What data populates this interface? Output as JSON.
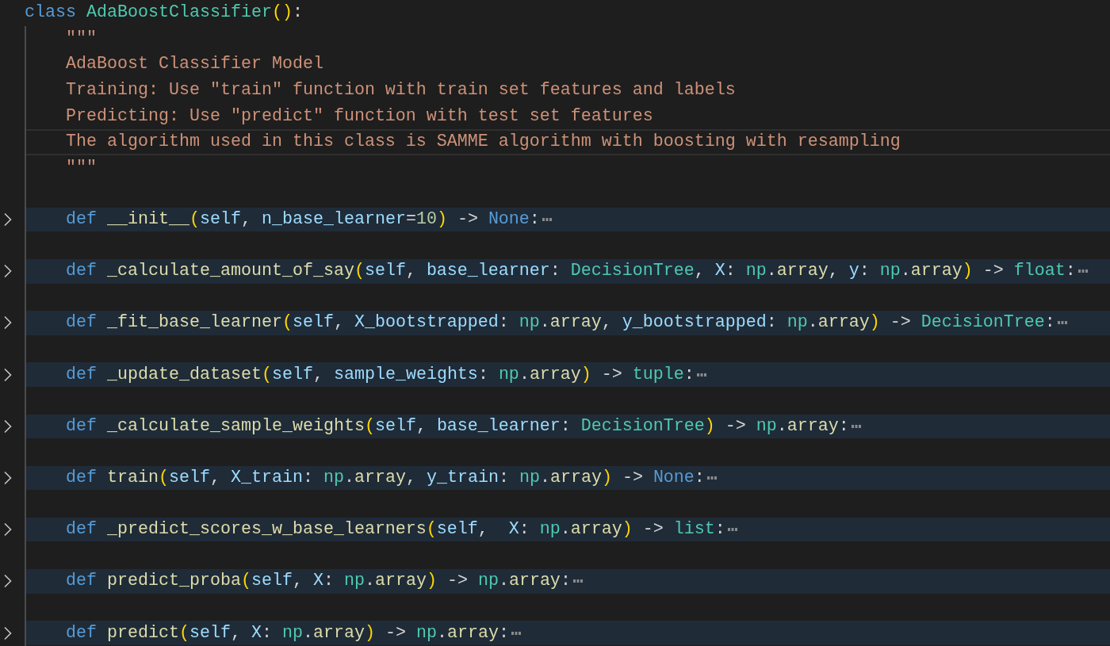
{
  "editor": {
    "lines": [
      {
        "kind": "code",
        "current": false,
        "tokens": [
          {
            "text": "class ",
            "kind": "keyword"
          },
          {
            "text": "AdaBoostClassifier",
            "kind": "class"
          },
          {
            "text": "()",
            "kind": "bracket"
          },
          {
            "text": ":",
            "kind": "plain"
          }
        ],
        "children": [
          {
            "kind": "code",
            "current": false,
            "tokens": [
              {
                "text": "\"\"\"",
                "kind": "string"
              }
            ]
          },
          {
            "kind": "code",
            "current": false,
            "tokens": [
              {
                "text": "AdaBoost Classifier Model",
                "kind": "string"
              }
            ]
          },
          {
            "kind": "code",
            "current": false,
            "tokens": [
              {
                "text": "Training: Use \"train\" function with train set features and labels",
                "kind": "string"
              }
            ]
          },
          {
            "kind": "code",
            "current": false,
            "tokens": [
              {
                "text": "Predicting: Use \"predict\" function with test set features",
                "kind": "string"
              }
            ]
          },
          {
            "kind": "code",
            "current": true,
            "tokens": [
              {
                "text": "The algorithm used in this class is SAMME algorithm with boosting with resampling",
                "kind": "string"
              }
            ]
          },
          {
            "kind": "code",
            "current": false,
            "tokens": [
              {
                "text": "\"\"\"",
                "kind": "string"
              }
            ]
          },
          {
            "kind": "blank",
            "current": false
          },
          {
            "kind": "folded",
            "current": false,
            "tokens": [
              {
                "text": "def ",
                "kind": "keyword"
              },
              {
                "text": "__init__",
                "kind": "function"
              },
              {
                "text": "(",
                "kind": "bracket"
              },
              {
                "text": "self",
                "kind": "param"
              },
              {
                "text": ", ",
                "kind": "plain"
              },
              {
                "text": "n_base_learner",
                "kind": "param"
              },
              {
                "text": "=",
                "kind": "plain"
              },
              {
                "text": "10",
                "kind": "number"
              },
              {
                "text": ")",
                "kind": "bracket"
              },
              {
                "text": " -> ",
                "kind": "plain"
              },
              {
                "text": "None",
                "kind": "constant"
              },
              {
                "text": ":",
                "kind": "plain"
              }
            ]
          },
          {
            "kind": "blank",
            "current": false
          },
          {
            "kind": "folded",
            "current": false,
            "tokens": [
              {
                "text": "def ",
                "kind": "keyword"
              },
              {
                "text": "_calculate_amount_of_say",
                "kind": "function"
              },
              {
                "text": "(",
                "kind": "bracket"
              },
              {
                "text": "self",
                "kind": "param"
              },
              {
                "text": ", ",
                "kind": "plain"
              },
              {
                "text": "base_learner",
                "kind": "param"
              },
              {
                "text": ": ",
                "kind": "plain"
              },
              {
                "text": "DecisionTree",
                "kind": "class"
              },
              {
                "text": ", ",
                "kind": "plain"
              },
              {
                "text": "X",
                "kind": "param"
              },
              {
                "text": ": ",
                "kind": "plain"
              },
              {
                "text": "np",
                "kind": "module"
              },
              {
                "text": ".",
                "kind": "plain"
              },
              {
                "text": "array",
                "kind": "function"
              },
              {
                "text": ", ",
                "kind": "plain"
              },
              {
                "text": "y",
                "kind": "param"
              },
              {
                "text": ": ",
                "kind": "plain"
              },
              {
                "text": "np",
                "kind": "module"
              },
              {
                "text": ".",
                "kind": "plain"
              },
              {
                "text": "array",
                "kind": "function"
              },
              {
                "text": ")",
                "kind": "bracket"
              },
              {
                "text": " -> ",
                "kind": "plain"
              },
              {
                "text": "float",
                "kind": "class"
              },
              {
                "text": ":",
                "kind": "plain"
              }
            ]
          },
          {
            "kind": "blank",
            "current": false
          },
          {
            "kind": "folded",
            "current": false,
            "tokens": [
              {
                "text": "def ",
                "kind": "keyword"
              },
              {
                "text": "_fit_base_learner",
                "kind": "function"
              },
              {
                "text": "(",
                "kind": "bracket"
              },
              {
                "text": "self",
                "kind": "param"
              },
              {
                "text": ", ",
                "kind": "plain"
              },
              {
                "text": "X_bootstrapped",
                "kind": "param"
              },
              {
                "text": ": ",
                "kind": "plain"
              },
              {
                "text": "np",
                "kind": "module"
              },
              {
                "text": ".",
                "kind": "plain"
              },
              {
                "text": "array",
                "kind": "function"
              },
              {
                "text": ", ",
                "kind": "plain"
              },
              {
                "text": "y_bootstrapped",
                "kind": "param"
              },
              {
                "text": ": ",
                "kind": "plain"
              },
              {
                "text": "np",
                "kind": "module"
              },
              {
                "text": ".",
                "kind": "plain"
              },
              {
                "text": "array",
                "kind": "function"
              },
              {
                "text": ")",
                "kind": "bracket"
              },
              {
                "text": " -> ",
                "kind": "plain"
              },
              {
                "text": "DecisionTree",
                "kind": "class"
              },
              {
                "text": ":",
                "kind": "plain"
              }
            ]
          },
          {
            "kind": "blank",
            "current": false
          },
          {
            "kind": "folded",
            "current": false,
            "tokens": [
              {
                "text": "def ",
                "kind": "keyword"
              },
              {
                "text": "_update_dataset",
                "kind": "function"
              },
              {
                "text": "(",
                "kind": "bracket"
              },
              {
                "text": "self",
                "kind": "param"
              },
              {
                "text": ", ",
                "kind": "plain"
              },
              {
                "text": "sample_weights",
                "kind": "param"
              },
              {
                "text": ": ",
                "kind": "plain"
              },
              {
                "text": "np",
                "kind": "module"
              },
              {
                "text": ".",
                "kind": "plain"
              },
              {
                "text": "array",
                "kind": "function"
              },
              {
                "text": ")",
                "kind": "bracket"
              },
              {
                "text": " -> ",
                "kind": "plain"
              },
              {
                "text": "tuple",
                "kind": "class"
              },
              {
                "text": ":",
                "kind": "plain"
              }
            ]
          },
          {
            "kind": "blank",
            "current": false
          },
          {
            "kind": "folded",
            "current": false,
            "tokens": [
              {
                "text": "def ",
                "kind": "keyword"
              },
              {
                "text": "_calculate_sample_weights",
                "kind": "function"
              },
              {
                "text": "(",
                "kind": "bracket"
              },
              {
                "text": "self",
                "kind": "param"
              },
              {
                "text": ", ",
                "kind": "plain"
              },
              {
                "text": "base_learner",
                "kind": "param"
              },
              {
                "text": ": ",
                "kind": "plain"
              },
              {
                "text": "DecisionTree",
                "kind": "class"
              },
              {
                "text": ")",
                "kind": "bracket"
              },
              {
                "text": " -> ",
                "kind": "plain"
              },
              {
                "text": "np",
                "kind": "module"
              },
              {
                "text": ".",
                "kind": "plain"
              },
              {
                "text": "array",
                "kind": "function"
              },
              {
                "text": ":",
                "kind": "plain"
              }
            ]
          },
          {
            "kind": "blank",
            "current": false
          },
          {
            "kind": "folded",
            "current": false,
            "tokens": [
              {
                "text": "def ",
                "kind": "keyword"
              },
              {
                "text": "train",
                "kind": "function"
              },
              {
                "text": "(",
                "kind": "bracket"
              },
              {
                "text": "self",
                "kind": "param"
              },
              {
                "text": ", ",
                "kind": "plain"
              },
              {
                "text": "X_train",
                "kind": "param"
              },
              {
                "text": ": ",
                "kind": "plain"
              },
              {
                "text": "np",
                "kind": "module"
              },
              {
                "text": ".",
                "kind": "plain"
              },
              {
                "text": "array",
                "kind": "function"
              },
              {
                "text": ", ",
                "kind": "plain"
              },
              {
                "text": "y_train",
                "kind": "param"
              },
              {
                "text": ": ",
                "kind": "plain"
              },
              {
                "text": "np",
                "kind": "module"
              },
              {
                "text": ".",
                "kind": "plain"
              },
              {
                "text": "array",
                "kind": "function"
              },
              {
                "text": ")",
                "kind": "bracket"
              },
              {
                "text": " -> ",
                "kind": "plain"
              },
              {
                "text": "None",
                "kind": "constant"
              },
              {
                "text": ":",
                "kind": "plain"
              }
            ]
          },
          {
            "kind": "blank",
            "current": false
          },
          {
            "kind": "folded",
            "current": false,
            "tokens": [
              {
                "text": "def ",
                "kind": "keyword"
              },
              {
                "text": "_predict_scores_w_base_learners",
                "kind": "function"
              },
              {
                "text": "(",
                "kind": "bracket"
              },
              {
                "text": "self",
                "kind": "param"
              },
              {
                "text": ",  ",
                "kind": "plain"
              },
              {
                "text": "X",
                "kind": "param"
              },
              {
                "text": ": ",
                "kind": "plain"
              },
              {
                "text": "np",
                "kind": "module"
              },
              {
                "text": ".",
                "kind": "plain"
              },
              {
                "text": "array",
                "kind": "function"
              },
              {
                "text": ")",
                "kind": "bracket"
              },
              {
                "text": " -> ",
                "kind": "plain"
              },
              {
                "text": "list",
                "kind": "class"
              },
              {
                "text": ":",
                "kind": "plain"
              }
            ]
          },
          {
            "kind": "blank",
            "current": false
          },
          {
            "kind": "folded",
            "current": false,
            "tokens": [
              {
                "text": "def ",
                "kind": "keyword"
              },
              {
                "text": "predict_proba",
                "kind": "function"
              },
              {
                "text": "(",
                "kind": "bracket"
              },
              {
                "text": "self",
                "kind": "param"
              },
              {
                "text": ", ",
                "kind": "plain"
              },
              {
                "text": "X",
                "kind": "param"
              },
              {
                "text": ": ",
                "kind": "plain"
              },
              {
                "text": "np",
                "kind": "module"
              },
              {
                "text": ".",
                "kind": "plain"
              },
              {
                "text": "array",
                "kind": "function"
              },
              {
                "text": ")",
                "kind": "bracket"
              },
              {
                "text": " -> ",
                "kind": "plain"
              },
              {
                "text": "np",
                "kind": "module"
              },
              {
                "text": ".",
                "kind": "plain"
              },
              {
                "text": "array",
                "kind": "function"
              },
              {
                "text": ":",
                "kind": "plain"
              }
            ]
          },
          {
            "kind": "blank",
            "current": false
          },
          {
            "kind": "folded",
            "current": false,
            "tokens": [
              {
                "text": "def ",
                "kind": "keyword"
              },
              {
                "text": "predict",
                "kind": "function"
              },
              {
                "text": "(",
                "kind": "bracket"
              },
              {
                "text": "self",
                "kind": "param"
              },
              {
                "text": ", ",
                "kind": "plain"
              },
              {
                "text": "X",
                "kind": "param"
              },
              {
                "text": ": ",
                "kind": "plain"
              },
              {
                "text": "np",
                "kind": "module"
              },
              {
                "text": ".",
                "kind": "plain"
              },
              {
                "text": "array",
                "kind": "function"
              },
              {
                "text": ")",
                "kind": "bracket"
              },
              {
                "text": " -> ",
                "kind": "plain"
              },
              {
                "text": "np",
                "kind": "module"
              },
              {
                "text": ".",
                "kind": "plain"
              },
              {
                "text": "array",
                "kind": "function"
              },
              {
                "text": ":",
                "kind": "plain"
              }
            ]
          }
        ]
      }
    ]
  }
}
